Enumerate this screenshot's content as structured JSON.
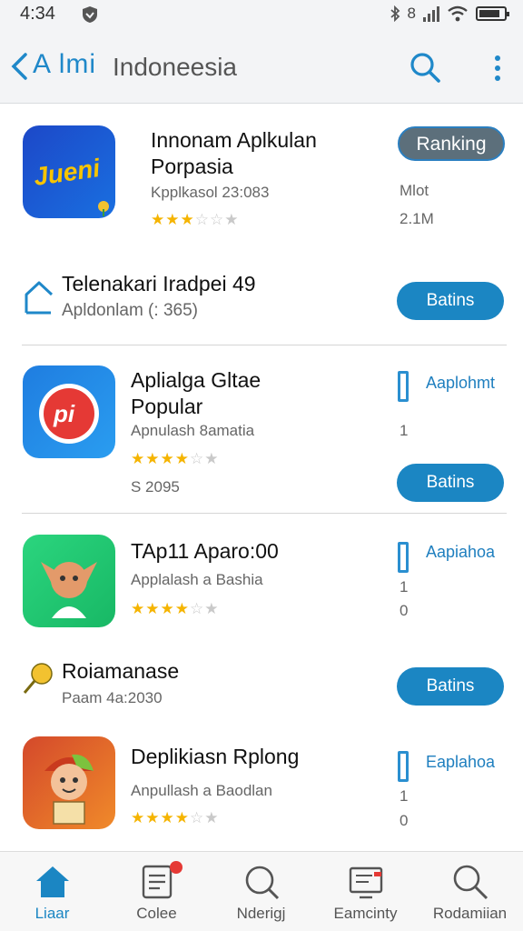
{
  "status_bar": {
    "time": "4:34",
    "signal_glyph": "8"
  },
  "header": {
    "logo_text": "A lmi",
    "title": "Indoneesia"
  },
  "list": [
    {
      "name_line1": "Innonam Aplkulan",
      "name_line2": "Porpasia",
      "sub": "Kpplkasol 23:083",
      "rating": 3,
      "meta1": "Mlot",
      "meta2": "2.1M",
      "badge_label": "Ranking"
    },
    {
      "name": "Telenakari Iradpei 49",
      "sub": "Apldonlam (: 365)",
      "button_label": "Batins"
    },
    {
      "name_line1": "Aplialga Gltae",
      "name_line2": "Popular",
      "sub": "Apnulash 8amatia",
      "rating": 4,
      "extra": "S 2095",
      "link_label": "Aaplohmt",
      "meta1": "1",
      "button_label": "Batins"
    },
    {
      "name": "TAp11 Aparo:00",
      "sub": "Applalash a Bashia",
      "rating": 4,
      "link_label": "Aapiahoa",
      "meta1": "1",
      "meta2": "0"
    },
    {
      "name": "Roiamanase",
      "sub": "Paam 4a:2030",
      "button_label": "Batins"
    },
    {
      "name": "Deplikiasn Rplong",
      "sub": "Anpullash a Baodlan",
      "rating": 4,
      "link_label": "Eaplahoa",
      "meta1": "1",
      "meta2": "0"
    }
  ],
  "icon_text": {
    "app1": "Jueni",
    "app3": "pi"
  },
  "bottom_nav": [
    {
      "label": "Liaar",
      "icon": "home-icon",
      "active": true
    },
    {
      "label": "Colee",
      "icon": "document-icon",
      "badge": "1"
    },
    {
      "label": "Nderigj",
      "icon": "search-icon"
    },
    {
      "label": "Eamcinty",
      "icon": "monitor-icon"
    },
    {
      "label": "Rodamiian",
      "icon": "search-icon"
    }
  ],
  "colors": {
    "accent": "#1b86c3",
    "star": "#f5b400",
    "badge": "#e53935"
  }
}
